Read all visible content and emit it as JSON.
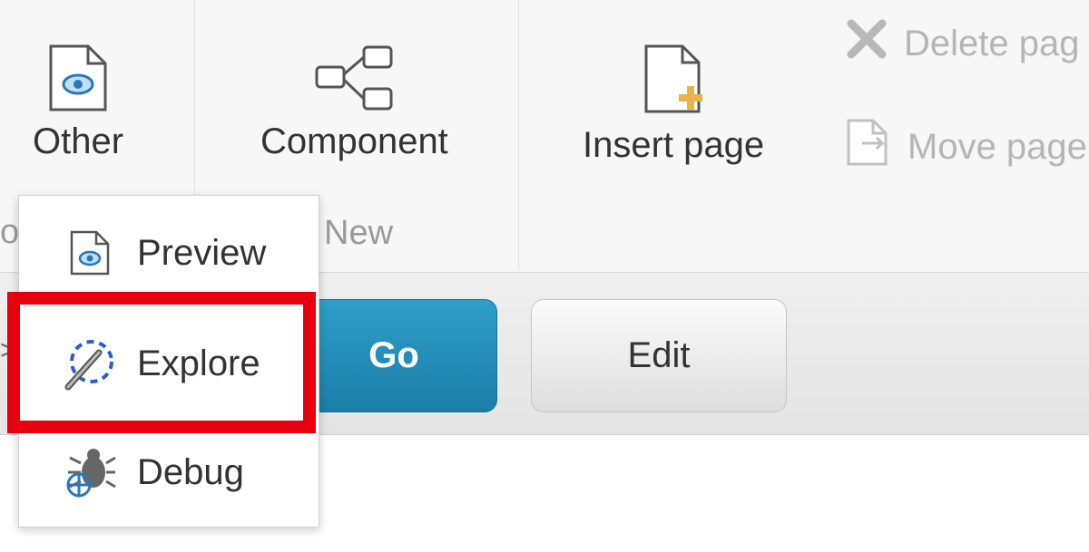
{
  "ribbon": {
    "other_label": "Other",
    "component_label": "Component",
    "insert_page_label": "Insert page",
    "delete_page_label": "Delete pag",
    "move_page_label": "Move page",
    "new_group_label": "New",
    "left_group_label_fragment": "o"
  },
  "toolbar": {
    "go_label": "Go",
    "edit_label": "Edit",
    "cut_arrow": ">"
  },
  "dropdown": {
    "items": [
      {
        "label": "Preview",
        "icon": "preview-page-icon"
      },
      {
        "label": "Explore",
        "icon": "explore-wand-icon"
      },
      {
        "label": "Debug",
        "icon": "debug-bug-icon"
      }
    ]
  },
  "colors": {
    "highlight": "#e8000e",
    "go_button": "#1b7ea8",
    "insert_plus": "#e8b34a"
  }
}
